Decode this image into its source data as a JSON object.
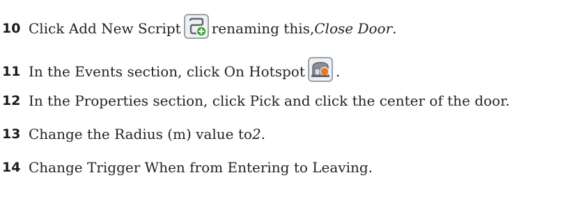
{
  "steps": [
    {
      "number": "10",
      "before": "Click Add New Script",
      "after": " renaming this, ",
      "italic": "Close Door",
      "end": ".",
      "icon": "add-script-icon"
    },
    {
      "number": "11",
      "before": "In the Events section, click On Hotspot",
      "after": " .",
      "icon": "on-hotspot-icon"
    },
    {
      "number": "12",
      "text": "In the Properties section, click Pick and click the center of the door."
    },
    {
      "number": "13",
      "before": "Change the Radius (m) value to ",
      "italic": "2",
      "end": "."
    },
    {
      "number": "14",
      "text": "Change Trigger When from Entering to Leaving."
    }
  ],
  "colors": {
    "icon_green": "#3aa63a",
    "icon_gray": "#8a8f94",
    "icon_orange": "#e07a2e"
  }
}
